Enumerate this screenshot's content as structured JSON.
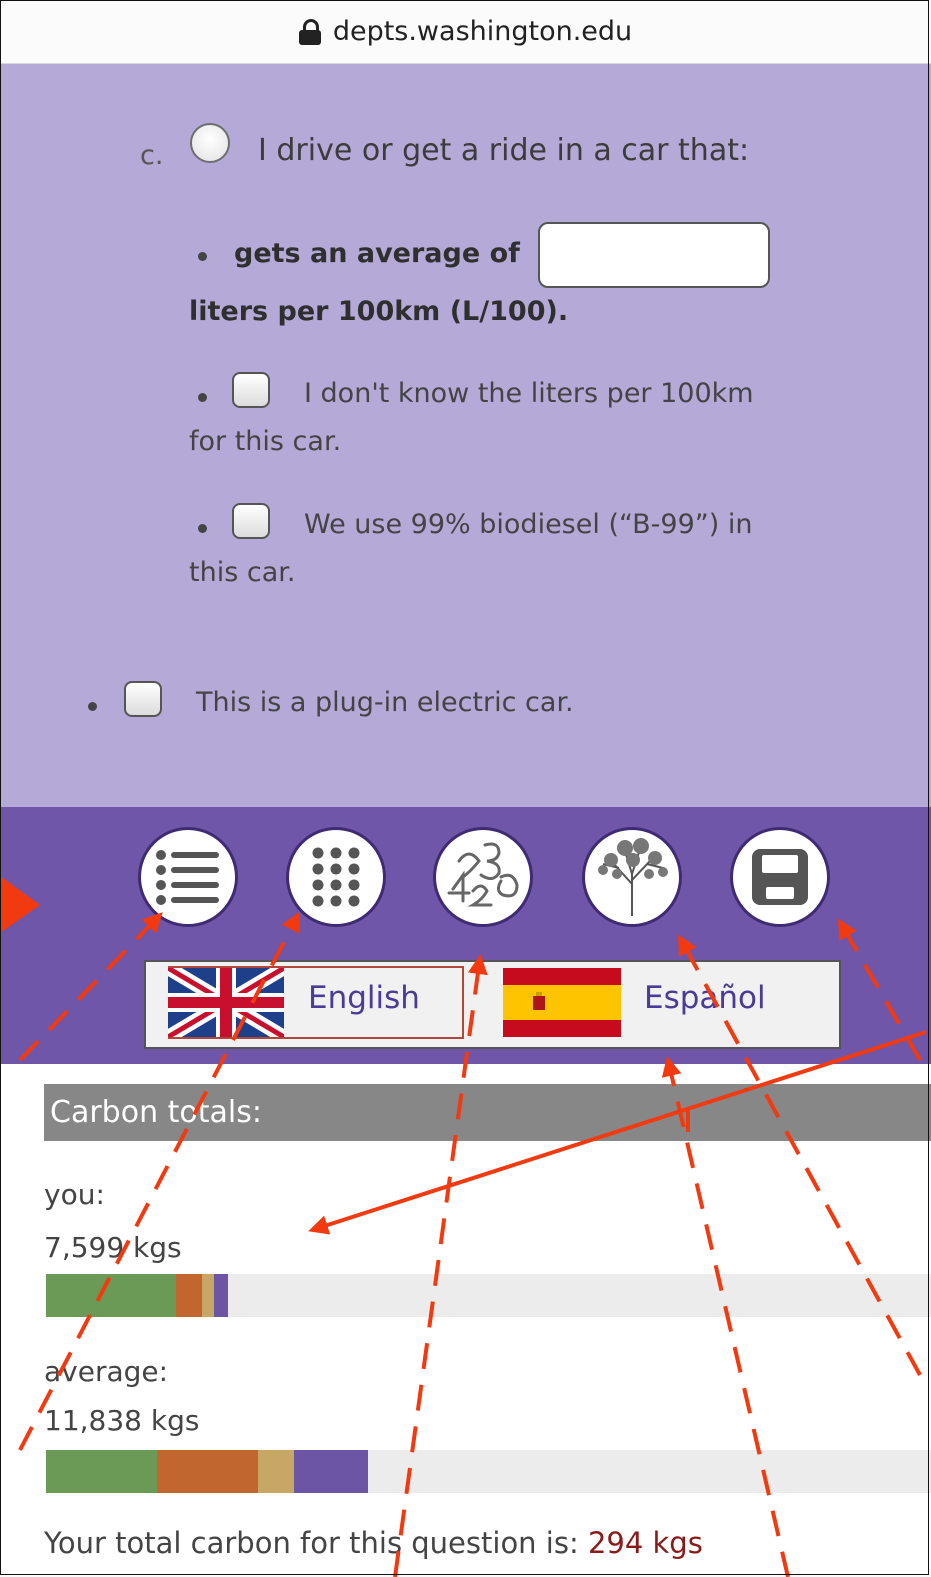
{
  "browser": {
    "url": "depts.washington.edu"
  },
  "question": {
    "letter": "c.",
    "option_label": "I drive or get a ride in a car that:",
    "mpg_prefix": "gets an average of",
    "mpg_value": "",
    "mpg_units": "liters per 100km (L/100).",
    "dont_know_line1": "I don't know the liters per 100km",
    "dont_know_line2": "for this car.",
    "biodiesel_line1": "We use 99% biodiesel (“B-99”) in",
    "biodiesel_line2": "this car.",
    "electric_label": "This is a plug-in electric car."
  },
  "toolbar": {
    "buttons": [
      {
        "icon": "list-icon"
      },
      {
        "icon": "grid-icon"
      },
      {
        "icon": "numbers-icon"
      },
      {
        "icon": "tree-icon"
      },
      {
        "icon": "save-icon"
      }
    ]
  },
  "languages": {
    "english": "English",
    "spanish": "Español"
  },
  "totals": {
    "header": "Carbon totals:",
    "you_label": "you:",
    "you_value": "7,599 kgs",
    "average_label": "average:",
    "average_value": "11,838 kgs",
    "you_bar": [
      {
        "value": 0.147,
        "color": "#6a9a55"
      },
      {
        "value": 0.029,
        "color": "#c0662e"
      },
      {
        "value": 0.014,
        "color": "#c7a765"
      },
      {
        "value": 0.016,
        "color": "#6d55a6"
      }
    ],
    "average_bar": [
      {
        "value": 0.125,
        "color": "#6a9a55"
      },
      {
        "value": 0.115,
        "color": "#c0662e"
      },
      {
        "value": 0.04,
        "color": "#c7a765"
      },
      {
        "value": 0.084,
        "color": "#6d55a6"
      }
    ],
    "question_total_prefix": "Your total carbon for this question is:",
    "question_total_value": "294 kgs"
  },
  "colors": {
    "annotation": "#f23a10",
    "toolbar": "#6f56a8",
    "question_bg": "#b5a9d7"
  }
}
